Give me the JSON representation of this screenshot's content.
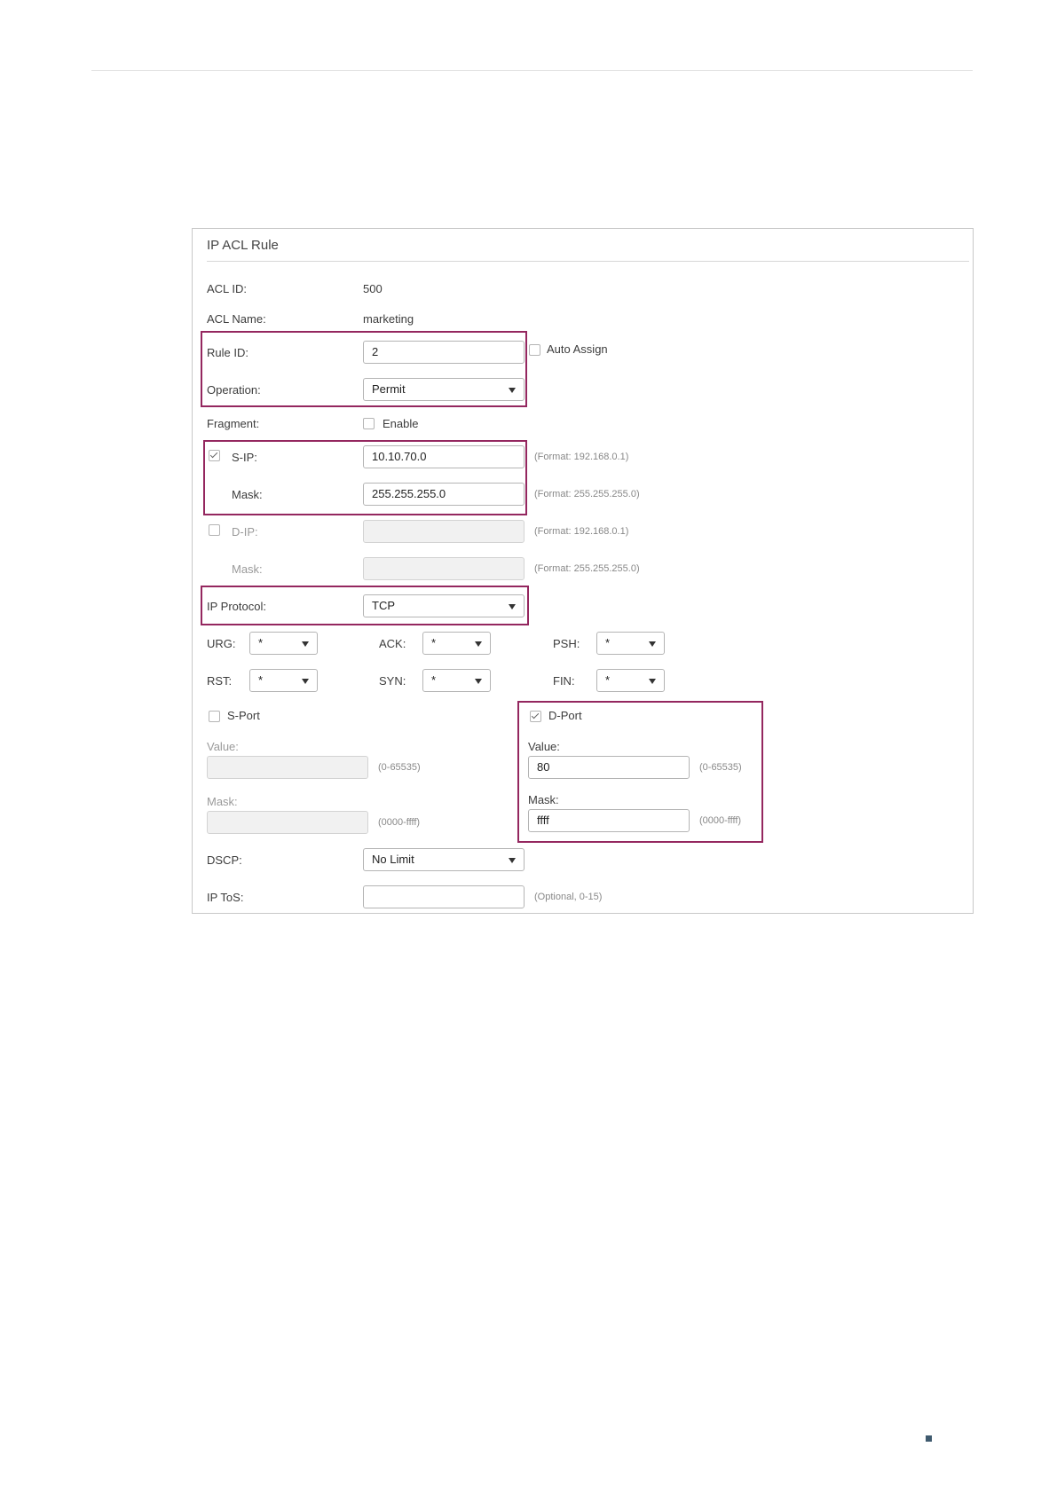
{
  "panel": {
    "title": "IP ACL Rule"
  },
  "acl_id": {
    "label": "ACL ID:",
    "value": "500"
  },
  "acl_name": {
    "label": "ACL Name:",
    "value": "marketing"
  },
  "rule_id": {
    "label": "Rule ID:",
    "value": "2",
    "auto_assign_label": "Auto Assign",
    "auto_assign_checked": false
  },
  "operation": {
    "label": "Operation:",
    "value": "Permit"
  },
  "fragment": {
    "label": "Fragment:",
    "enable_label": "Enable",
    "checked": false
  },
  "s_ip": {
    "label": "S-IP:",
    "checked": true,
    "value": "10.10.70.0",
    "hint": "(Format: 192.168.0.1)",
    "mask_label": "Mask:",
    "mask_value": "255.255.255.0",
    "mask_hint": "(Format: 255.255.255.0)"
  },
  "d_ip": {
    "label": "D-IP:",
    "checked": false,
    "value": "",
    "hint": "(Format: 192.168.0.1)",
    "mask_label": "Mask:",
    "mask_value": "",
    "mask_hint": "(Format: 255.255.255.0)"
  },
  "ip_protocol": {
    "label": "IP Protocol:",
    "value": "TCP"
  },
  "tcp_flags": {
    "urg": {
      "label": "URG:",
      "value": "*"
    },
    "ack": {
      "label": "ACK:",
      "value": "*"
    },
    "psh": {
      "label": "PSH:",
      "value": "*"
    },
    "rst": {
      "label": "RST:",
      "value": "*"
    },
    "syn": {
      "label": "SYN:",
      "value": "*"
    },
    "fin": {
      "label": "FIN:",
      "value": "*"
    }
  },
  "s_port": {
    "label": "S-Port",
    "checked": false,
    "value_label": "Value:",
    "value": "",
    "value_hint": "(0-65535)",
    "mask_label": "Mask:",
    "mask_value": "",
    "mask_hint": "(0000-ffff)"
  },
  "d_port": {
    "label": "D-Port",
    "checked": true,
    "value_label": "Value:",
    "value": "80",
    "value_hint": "(0-65535)",
    "mask_label": "Mask:",
    "mask_value": "ffff",
    "mask_hint": "(0000-ffff)"
  },
  "dscp": {
    "label": "DSCP:",
    "value": "No Limit"
  },
  "ip_tos": {
    "label": "IP ToS:",
    "value": "",
    "hint": "(Optional, 0-15)"
  },
  "colors": {
    "highlight": "#94275f",
    "corner_marker": "#3f5a6e"
  }
}
